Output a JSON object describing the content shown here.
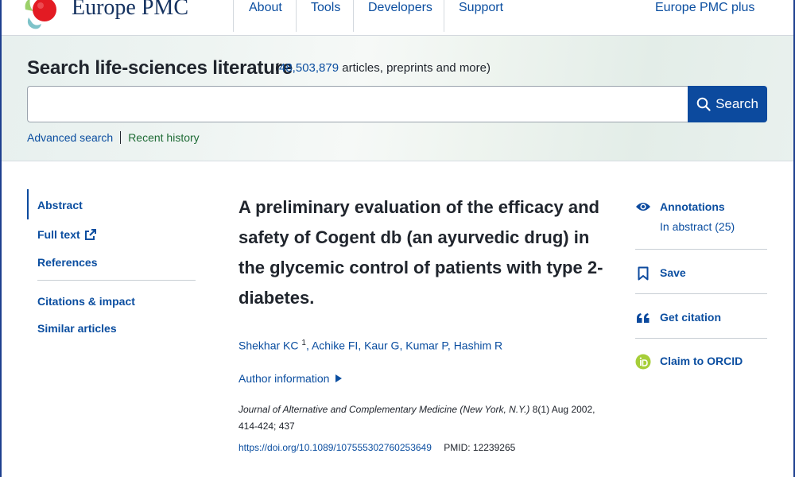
{
  "header": {
    "brand": "Europe PMC",
    "nav": [
      "About",
      "Tools",
      "Developers",
      "Support"
    ],
    "plus_link": "Europe PMC plus"
  },
  "search": {
    "title": "Search life-sciences literature",
    "count_prefix": "(",
    "count": "48,503,879",
    "count_suffix": " articles, preprints and more)",
    "input_value": "",
    "button_label": "Search",
    "advanced_link": "Advanced search",
    "history_link": "Recent history"
  },
  "left_nav": {
    "abstract": "Abstract",
    "full_text": "Full text",
    "references": "References",
    "citations": "Citations & impact",
    "similar": "Similar articles"
  },
  "article": {
    "title": "A preliminary evaluation of the efficacy and safety of Cogent db (an ayurvedic drug) in the glycemic control of patients with type 2-diabetes.",
    "authors": [
      {
        "name": "Shekhar KC",
        "sup": "1"
      },
      {
        "name": "Achike FI"
      },
      {
        "name": "Kaur G"
      },
      {
        "name": "Kumar P"
      },
      {
        "name": "Hashim R"
      }
    ],
    "author_info": "Author information",
    "journal_name": "Journal of Alternative and Complementary Medicine (New York, N.Y.)",
    "journal_rest": " 8(1) Aug 2002, 414-424; 437",
    "doi": "https://doi.org/10.1089/107555302760253649",
    "pmid": "PMID: 12239265"
  },
  "right_panel": {
    "annotations": "Annotations",
    "annotations_sub": "In abstract (25)",
    "save": "Save",
    "citation": "Get citation",
    "orcid": "Claim to ORCID"
  },
  "colors": {
    "link": "#0b4ea0",
    "primary_button": "#0c4a9e",
    "orcid_green": "#a6ce39",
    "logo_red": "#e31b23"
  }
}
